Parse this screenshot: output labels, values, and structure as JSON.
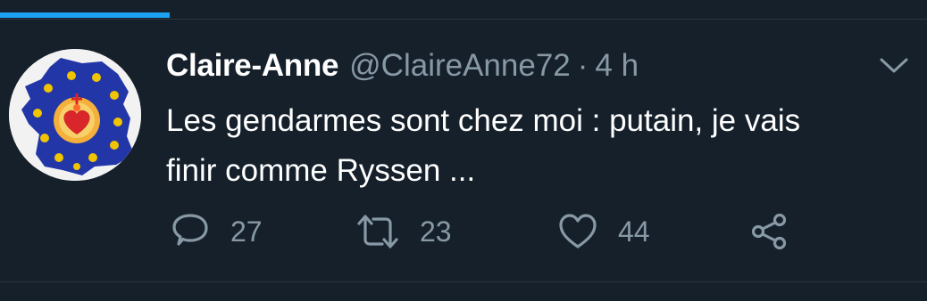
{
  "tweet": {
    "display_name": "Claire-Anne",
    "handle": "@ClaireAnne72",
    "separator": "·",
    "time": "4 h",
    "text_line1": "Les gendarmes sont chez moi : putain, je vais",
    "text_line2": "finir comme Ryssen ..."
  },
  "actions": {
    "reply_count": "27",
    "retweet_count": "23",
    "like_count": "44"
  },
  "icons": {
    "reply": "reply-icon",
    "retweet": "retweet-icon",
    "like": "heart-icon",
    "share": "share-icon",
    "menu": "chevron-down-icon"
  },
  "colors": {
    "background": "#15202b",
    "accent": "#1da1f2",
    "secondary_text": "#8899a6"
  }
}
